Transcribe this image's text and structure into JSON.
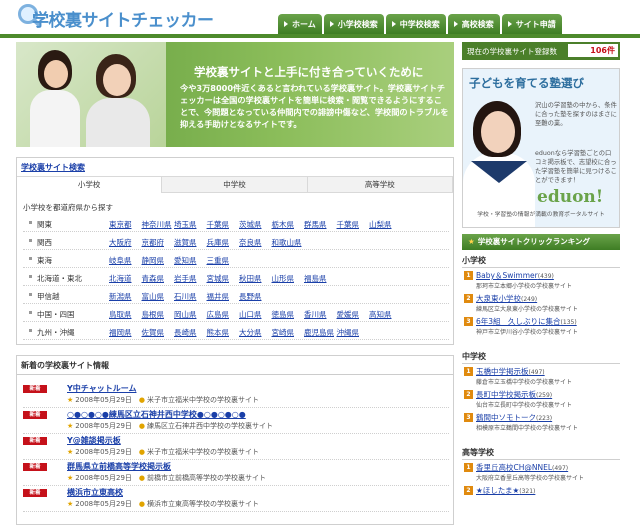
{
  "header": {
    "logo_text": "学校裏サイトチェッカー",
    "nav": [
      "ホーム",
      "小学校検索",
      "中学校検索",
      "高校検索",
      "サイト申請"
    ]
  },
  "hero": {
    "title": "学校裏サイトと上手に付き合っていくために",
    "text": "今や3万8000件近くあると言われている学校裏サイト。学校裏サイトチェッカーは全国の学校裏サイトを簡単に検索・閲覧できるようにすることで、今問題となっている仲間内での誹謗中傷など、学校間のトラブルを抑える手助けとなるサイトです。"
  },
  "search": {
    "title": "学校裏サイト検索",
    "tabs": [
      "小学校",
      "中学校",
      "高等学校"
    ],
    "prompt": "小学校を都道府県から探す",
    "regions": [
      {
        "name": "関東",
        "prefs": [
          "東京都",
          "神奈川県",
          "埼玉県",
          "千葉県",
          "茨城県",
          "栃木県",
          "群馬県",
          "千葉県",
          "山梨県"
        ]
      },
      {
        "name": "関西",
        "prefs": [
          "大阪府",
          "京都府",
          "滋賀県",
          "兵庫県",
          "奈良県",
          "和歌山県"
        ]
      },
      {
        "name": "東海",
        "prefs": [
          "岐阜県",
          "静岡県",
          "愛知県",
          "三重県"
        ]
      },
      {
        "name": "北海道・東北",
        "prefs": [
          "北海道",
          "青森県",
          "岩手県",
          "宮城県",
          "秋田県",
          "山形県",
          "福島県"
        ]
      },
      {
        "name": "甲信越",
        "prefs": [
          "新潟県",
          "富山県",
          "石川県",
          "福井県",
          "長野県"
        ]
      },
      {
        "name": "中国・四国",
        "prefs": [
          "鳥取県",
          "島根県",
          "岡山県",
          "広島県",
          "山口県",
          "徳島県",
          "香川県",
          "愛媛県",
          "高知県"
        ]
      },
      {
        "name": "九州・沖縄",
        "prefs": [
          "福岡県",
          "佐賀県",
          "長崎県",
          "熊本県",
          "大分県",
          "宮崎県",
          "鹿児島県",
          "沖縄県"
        ]
      }
    ]
  },
  "news": {
    "title": "新着の学校裏サイト情報",
    "badge": "新着",
    "items": [
      {
        "title": "Y中チャットルーム",
        "date": "2008年05月29日",
        "desc": "米子市立福米中学校の学校裏サイト"
      },
      {
        "title": "○●○●○●練馬区立石神井西中学校●○●○●○●",
        "date": "2008年05月29日",
        "desc": "練馬区立石神井西中学校の学校裏サイト"
      },
      {
        "title": "Y@雑談掲示板",
        "date": "2008年05月29日",
        "desc": "米子市立福米中学校の学校裏サイト"
      },
      {
        "title": "群馬県立前橋高等学校掲示板",
        "date": "2008年05月29日",
        "desc": "前橋市立前橋高等学校の学校裏サイト"
      },
      {
        "title": "横浜市立東高校",
        "date": "2008年05月29日",
        "desc": "横浜市立東高等学校の学校裏サイト"
      }
    ]
  },
  "sidebar": {
    "count_label": "現在の学校裏サイト登録数",
    "count_value": "106件",
    "ad": {
      "title": "子どもを育てる塾選び",
      "text1": "沢山の学習塾の中から、条件に合った塾を探すのはまさに至難の業。",
      "text2": "eduonなら学習塾ごとの口コミ掲示板で、志望校に合った学習塾を簡単に見つけることができます！",
      "logo": "eduon!",
      "footer": "学校・学習塾の情報が満載の教育ポータルサイト"
    },
    "ranking_title": "学校裏サイトクリックランキング",
    "categories": [
      {
        "label": "小学校",
        "items": [
          {
            "rank": "1",
            "name": "Baby＆Swimmer",
            "count": "(439)",
            "sub": "那珂市立本郷小学校の学校裏サイト"
          },
          {
            "rank": "2",
            "name": "大泉東小学校",
            "count": "(249)",
            "sub": "練馬区立大泉東小学校の学校裏サイト"
          },
          {
            "rank": "3",
            "name": "6年3組　久しぶりに集合",
            "count": "(135)",
            "sub": "神戸市立伊川谷小学校の学校裏サイト"
          }
        ]
      },
      {
        "label": "中学校",
        "items": [
          {
            "rank": "1",
            "name": "玉橋中学掲示板",
            "count": "(497)",
            "sub": "藤倉市立玉橋中学校の学校裏サイト"
          },
          {
            "rank": "2",
            "name": "長町中学校掲示板",
            "count": "(259)",
            "sub": "仙台市立長町中学校の学校裏サイト"
          },
          {
            "rank": "3",
            "name": "鶴間中ソモトーク",
            "count": "(223)",
            "sub": "相模原市立鶴間中学校の学校裏サイト"
          }
        ]
      },
      {
        "label": "高等学校",
        "items": [
          {
            "rank": "1",
            "name": "香里丘高校CH@NNEL",
            "count": "(497)",
            "sub": "大阪府立香里丘高等学校の学校裏サイト"
          },
          {
            "rank": "2",
            "name": "★ほしたま★",
            "count": "(321)",
            "sub": ""
          }
        ]
      }
    ]
  },
  "colors": {
    "nav_green": "#3e7d24",
    "badge_red": "#c5111a",
    "link_blue": "#1a3fa8",
    "rank_orange": "#e08a0e"
  }
}
